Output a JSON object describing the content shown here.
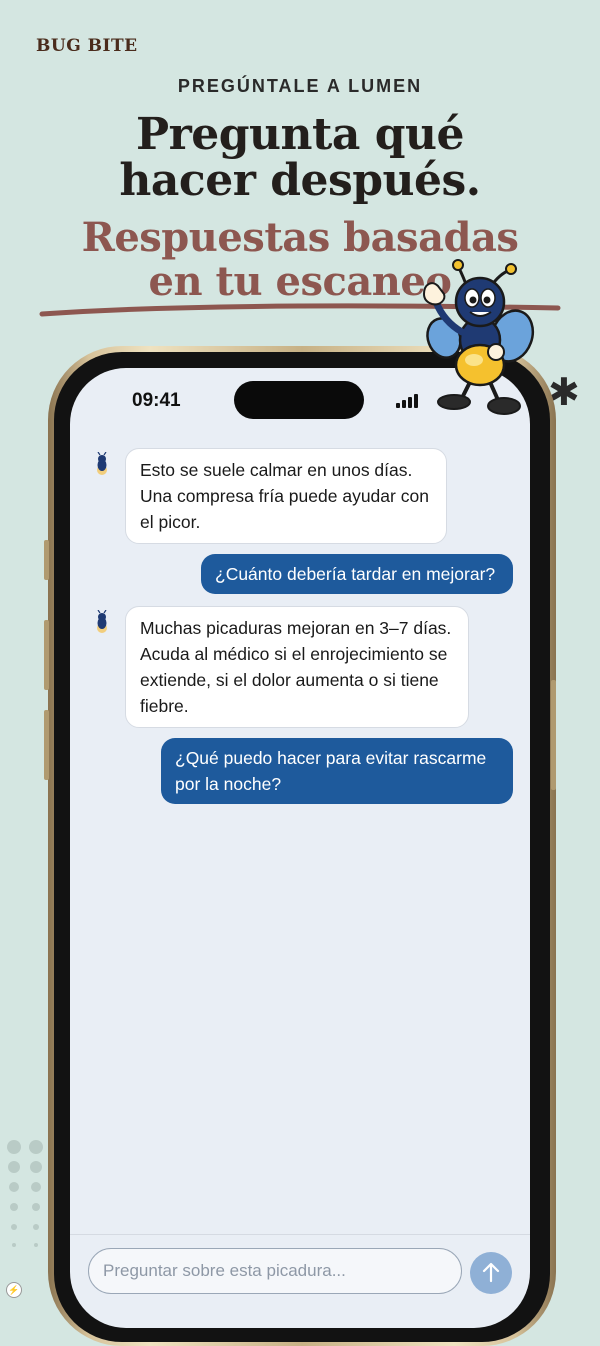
{
  "header": {
    "brand": "BUG BITE",
    "eyebrow": "PREGÚNTALE A LUMEN",
    "headline_line1": "Pregunta qué",
    "headline_line2": "hacer después.",
    "subhead_line1": "Respuestas basadas",
    "subhead_line2": "en tu escaneo"
  },
  "status_bar": {
    "time": "09:41"
  },
  "chat": {
    "messages": [
      {
        "from": "bot",
        "text": "Esto se suele calmar en unos días. Una compresa fría puede ayudar con el picor."
      },
      {
        "from": "user",
        "text": "¿Cuánto debería tardar en mejorar?"
      },
      {
        "from": "bot",
        "text": "Muchas picaduras mejoran en 3–7 días. Acuda al médico si el enrojecimiento se extiende, si el dolor aumenta o si tiene fiebre."
      },
      {
        "from": "user",
        "text": "¿Qué puedo hacer para evitar rascarme por la noche?"
      }
    ]
  },
  "composer": {
    "placeholder": "Preguntar sobre esta picadura...",
    "send_icon": "arrow-up-icon"
  },
  "colors": {
    "background": "#d4e6e1",
    "headline": "#231f1c",
    "subhead": "#8d5750",
    "user_bubble": "#1e5a9c",
    "send_button": "#8fb0d6"
  }
}
